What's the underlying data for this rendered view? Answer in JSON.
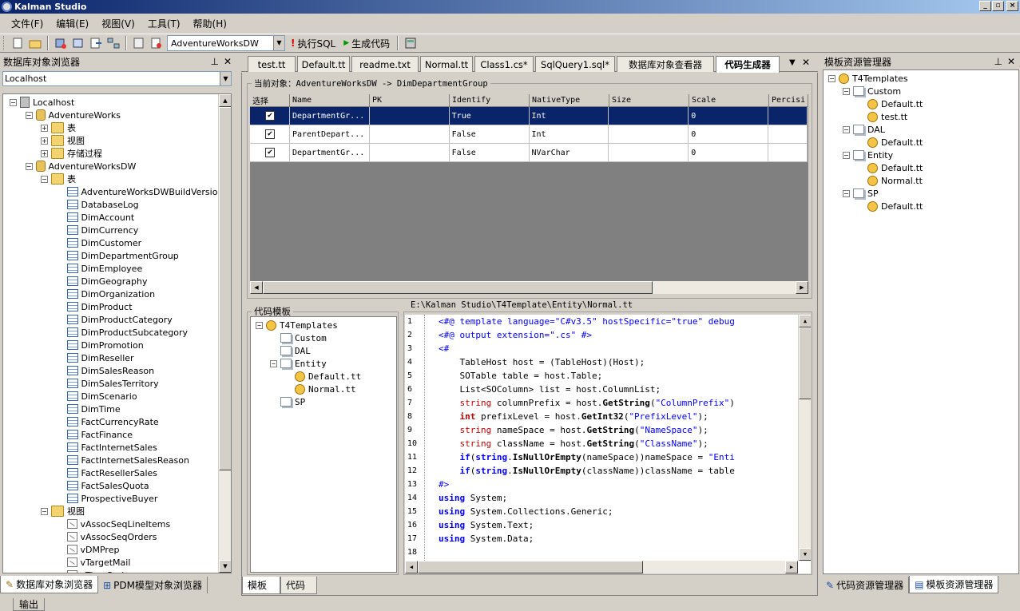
{
  "window": {
    "title": "Kalman Studio",
    "min": "_",
    "max": "▫",
    "close": "×"
  },
  "menu": [
    "文件(F)",
    "编辑(E)",
    "视图(V)",
    "工具(T)",
    "帮助(H)"
  ],
  "toolbar": {
    "db_selected": "AdventureWorksDW",
    "exec_sql": "执行SQL",
    "gen_code": "生成代码"
  },
  "left_panel": {
    "title": "数据库对象浏览器",
    "server_combo": "Localhost",
    "tree": [
      {
        "label": "Localhost",
        "level": 0,
        "icon": "server-icon",
        "exp": "−"
      },
      {
        "label": "AdventureWorks",
        "level": 1,
        "icon": "database-icon",
        "exp": "−"
      },
      {
        "label": "表",
        "level": 2,
        "icon": "folder-icon",
        "exp": "+"
      },
      {
        "label": "视图",
        "level": 2,
        "icon": "folder-icon",
        "exp": "+"
      },
      {
        "label": "存储过程",
        "level": 2,
        "icon": "folder-icon",
        "exp": "+"
      },
      {
        "label": "AdventureWorksDW",
        "level": 1,
        "icon": "database-icon",
        "exp": "−"
      },
      {
        "label": "表",
        "level": 2,
        "icon": "folder-icon",
        "exp": "−"
      },
      {
        "label": "AdventureWorksDWBuildVersion",
        "level": 3,
        "icon": "table-icon"
      },
      {
        "label": "DatabaseLog",
        "level": 3,
        "icon": "table-icon"
      },
      {
        "label": "DimAccount",
        "level": 3,
        "icon": "table-icon"
      },
      {
        "label": "DimCurrency",
        "level": 3,
        "icon": "table-icon"
      },
      {
        "label": "DimCustomer",
        "level": 3,
        "icon": "table-icon"
      },
      {
        "label": "DimDepartmentGroup",
        "level": 3,
        "icon": "table-icon"
      },
      {
        "label": "DimEmployee",
        "level": 3,
        "icon": "table-icon"
      },
      {
        "label": "DimGeography",
        "level": 3,
        "icon": "table-icon"
      },
      {
        "label": "DimOrganization",
        "level": 3,
        "icon": "table-icon"
      },
      {
        "label": "DimProduct",
        "level": 3,
        "icon": "table-icon"
      },
      {
        "label": "DimProductCategory",
        "level": 3,
        "icon": "table-icon"
      },
      {
        "label": "DimProductSubcategory",
        "level": 3,
        "icon": "table-icon"
      },
      {
        "label": "DimPromotion",
        "level": 3,
        "icon": "table-icon"
      },
      {
        "label": "DimReseller",
        "level": 3,
        "icon": "table-icon"
      },
      {
        "label": "DimSalesReason",
        "level": 3,
        "icon": "table-icon"
      },
      {
        "label": "DimSalesTerritory",
        "level": 3,
        "icon": "table-icon"
      },
      {
        "label": "DimScenario",
        "level": 3,
        "icon": "table-icon"
      },
      {
        "label": "DimTime",
        "level": 3,
        "icon": "table-icon"
      },
      {
        "label": "FactCurrencyRate",
        "level": 3,
        "icon": "table-icon"
      },
      {
        "label": "FactFinance",
        "level": 3,
        "icon": "table-icon"
      },
      {
        "label": "FactInternetSales",
        "level": 3,
        "icon": "table-icon"
      },
      {
        "label": "FactInternetSalesReason",
        "level": 3,
        "icon": "table-icon"
      },
      {
        "label": "FactResellerSales",
        "level": 3,
        "icon": "table-icon"
      },
      {
        "label": "FactSalesQuota",
        "level": 3,
        "icon": "table-icon"
      },
      {
        "label": "ProspectiveBuyer",
        "level": 3,
        "icon": "table-icon"
      },
      {
        "label": "视图",
        "level": 2,
        "icon": "folder-icon",
        "exp": "−"
      },
      {
        "label": "vAssocSeqLineItems",
        "level": 3,
        "icon": "view-icon"
      },
      {
        "label": "vAssocSeqOrders",
        "level": 3,
        "icon": "view-icon"
      },
      {
        "label": "vDMPrep",
        "level": 3,
        "icon": "view-icon"
      },
      {
        "label": "vTargetMail",
        "level": 3,
        "icon": "view-icon"
      },
      {
        "label": "vTimeSeries",
        "level": 3,
        "icon": "view-icon"
      }
    ],
    "bottom_tabs": [
      "数据库对象浏览器",
      "PDM模型对象浏览器"
    ]
  },
  "doc_tabs": [
    "test.tt",
    "Default.tt",
    "readme.txt",
    "Normal.tt",
    "Class1.cs*",
    "SqlQuery1.sql*",
    "数据库对象查看器",
    "代码生成器"
  ],
  "current_object": {
    "label": "当前对象：AdventureWorksDW -> DimDepartmentGroup"
  },
  "grid": {
    "columns": [
      "选择",
      "Name",
      "PK",
      "Identify",
      "NativeType",
      "Size",
      "Scale",
      "Percisi"
    ],
    "rows": [
      {
        "checked": "✔",
        "name": "DepartmentGr...",
        "pk": "",
        "identify": "True",
        "type": "Int",
        "size": "",
        "scale": "0",
        "perc": ""
      },
      {
        "checked": "✔",
        "name": "ParentDepart...",
        "pk": "",
        "identify": "False",
        "type": "Int",
        "size": "",
        "scale": "0",
        "perc": ""
      },
      {
        "checked": "✔",
        "name": "DepartmentGr...",
        "pk": "",
        "identify": "False",
        "type": "NVarChar",
        "size": "",
        "scale": "0",
        "perc": ""
      }
    ]
  },
  "template_panel": {
    "title": "代码模板",
    "tree": [
      {
        "label": "T4Templates",
        "level": 0,
        "icon": "t4-icon",
        "exp": "−"
      },
      {
        "label": "Custom",
        "level": 1,
        "icon": "folder-icon"
      },
      {
        "label": "DAL",
        "level": 1,
        "icon": "folder-icon"
      },
      {
        "label": "Entity",
        "level": 1,
        "icon": "folder-icon",
        "exp": "−"
      },
      {
        "label": "Default.tt",
        "level": 2,
        "icon": "tt-icon"
      },
      {
        "label": "Normal.tt",
        "level": 2,
        "icon": "tt-icon"
      },
      {
        "label": "SP",
        "level": 1,
        "icon": "folder-icon"
      }
    ]
  },
  "editor": {
    "path": "E:\\Kalman Studio\\T4Template\\Entity\\Normal.tt",
    "lines": [
      [
        [
          "<#@ template language=\"C#v3.5\" hostSpecific=\"true\" debug",
          "k"
        ]
      ],
      [
        [
          "<#@ output extension=\".cs\" #>",
          "k"
        ]
      ],
      [
        [
          "<#",
          "k"
        ]
      ],
      [
        [
          "    TableHost host = (TableHost)(Host);",
          ""
        ]
      ],
      [
        [
          "    SOTable table = host.Table;",
          ""
        ]
      ],
      [
        [
          "    List<SOColumn> list = host.ColumnList;",
          ""
        ]
      ],
      [
        [
          "    ",
          ""
        ],
        [
          "string",
          "r"
        ],
        [
          " columnPrefix = host.",
          ""
        ],
        [
          "GetString",
          "b"
        ],
        [
          "(",
          ""
        ],
        [
          "\"ColumnPrefix\"",
          "k"
        ],
        [
          ")",
          ""
        ]
      ],
      [
        [
          "    ",
          ""
        ],
        [
          "int",
          "rb"
        ],
        [
          " prefixLevel = host.",
          ""
        ],
        [
          "GetInt32",
          "b"
        ],
        [
          "(",
          ""
        ],
        [
          "\"PrefixLevel\"",
          "k"
        ],
        [
          ");",
          ""
        ]
      ],
      [
        [
          "    ",
          ""
        ],
        [
          "string",
          "r"
        ],
        [
          " nameSpace = host.",
          ""
        ],
        [
          "GetString",
          "b"
        ],
        [
          "(",
          ""
        ],
        [
          "\"NameSpace\"",
          "k"
        ],
        [
          ");",
          ""
        ]
      ],
      [
        [
          "    ",
          ""
        ],
        [
          "string",
          "r"
        ],
        [
          " className = host.",
          ""
        ],
        [
          "GetString",
          "b"
        ],
        [
          "(",
          ""
        ],
        [
          "\"ClassName\"",
          "k"
        ],
        [
          ");",
          ""
        ]
      ],
      [
        [
          "    ",
          ""
        ],
        [
          "if",
          "kb"
        ],
        [
          "(",
          ""
        ],
        [
          "string",
          "kb"
        ],
        [
          ".",
          ""
        ],
        [
          "IsNullOrEmpty",
          "b"
        ],
        [
          "(nameSpace))nameSpace = ",
          ""
        ],
        [
          "\"Enti",
          "k"
        ]
      ],
      [
        [
          "    ",
          ""
        ],
        [
          "if",
          "kb"
        ],
        [
          "(",
          ""
        ],
        [
          "string",
          "kb"
        ],
        [
          ".",
          ""
        ],
        [
          "IsNullOrEmpty",
          "b"
        ],
        [
          "(className))className = table",
          ""
        ]
      ],
      [
        [
          "#>",
          "k"
        ]
      ],
      [
        [
          "using",
          "kb"
        ],
        [
          " System;",
          ""
        ]
      ],
      [
        [
          "using",
          "kb"
        ],
        [
          " System.Collections.Generic;",
          ""
        ]
      ],
      [
        [
          "using",
          "kb"
        ],
        [
          " System.Text;",
          ""
        ]
      ],
      [
        [
          "using",
          "kb"
        ],
        [
          " System.Data;",
          ""
        ]
      ],
      [
        [
          "",
          ""
        ]
      ]
    ]
  },
  "center_bottom_tabs": [
    "模板",
    "代码"
  ],
  "right_panel": {
    "title": "模板资源管理器",
    "tree": [
      {
        "label": "T4Templates",
        "level": 0,
        "icon": "t4-icon",
        "exp": "−"
      },
      {
        "label": "Custom",
        "level": 1,
        "icon": "folder-icon",
        "exp": "−"
      },
      {
        "label": "Default.tt",
        "level": 2,
        "icon": "tt-icon"
      },
      {
        "label": "test.tt",
        "level": 2,
        "icon": "tt-icon"
      },
      {
        "label": "DAL",
        "level": 1,
        "icon": "folder-icon",
        "exp": "−"
      },
      {
        "label": "Default.tt",
        "level": 2,
        "icon": "tt-icon"
      },
      {
        "label": "Entity",
        "level": 1,
        "icon": "folder-icon",
        "exp": "−"
      },
      {
        "label": "Default.tt",
        "level": 2,
        "icon": "tt-icon"
      },
      {
        "label": "Normal.tt",
        "level": 2,
        "icon": "tt-icon"
      },
      {
        "label": "SP",
        "level": 1,
        "icon": "folder-icon",
        "exp": "−"
      },
      {
        "label": "Default.tt",
        "level": 2,
        "icon": "tt-icon"
      }
    ],
    "bottom_tabs": [
      "代码资源管理器",
      "模板资源管理器"
    ]
  },
  "status": {
    "output_tab": "输出"
  },
  "colors": {
    "title_start": "#0a246a",
    "title_end": "#a6caf0",
    "selection": "#0a246a",
    "keyword": "#0000ff",
    "type": "#c00000"
  }
}
